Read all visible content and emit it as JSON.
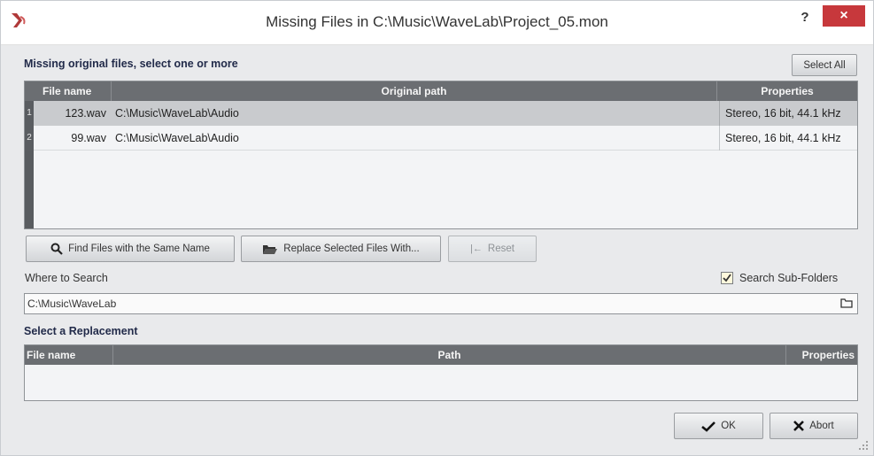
{
  "window": {
    "title": "Missing Files in C:\\Music\\WaveLab\\Project_05.mon",
    "help_label": "?",
    "close_label": "×"
  },
  "missing": {
    "heading": "Missing original files, select one or more",
    "select_all_label": "Select All",
    "columns": [
      "File name",
      "Original path",
      "Properties"
    ],
    "rows": [
      {
        "num": "1",
        "file": "123.wav",
        "path": "C:\\Music\\WaveLab\\Audio",
        "props": "Stereo, 16 bit, 44.1 kHz"
      },
      {
        "num": "2",
        "file": "99.wav",
        "path": "C:\\Music\\WaveLab\\Audio",
        "props": "Stereo, 16 bit, 44.1 kHz"
      }
    ]
  },
  "actions": {
    "find_label": "Find Files with the Same Name",
    "replace_label": "Replace Selected Files With...",
    "reset_label": "Reset"
  },
  "search": {
    "label": "Where to Search",
    "subfolders_label": "Search Sub-Folders",
    "subfolders_checked": true,
    "path_value": "C:\\Music\\WaveLab"
  },
  "replacement": {
    "heading": "Select a Replacement",
    "columns": [
      "File name",
      "Path",
      "Properties"
    ]
  },
  "footer": {
    "ok_label": "OK",
    "abort_label": "Abort"
  }
}
